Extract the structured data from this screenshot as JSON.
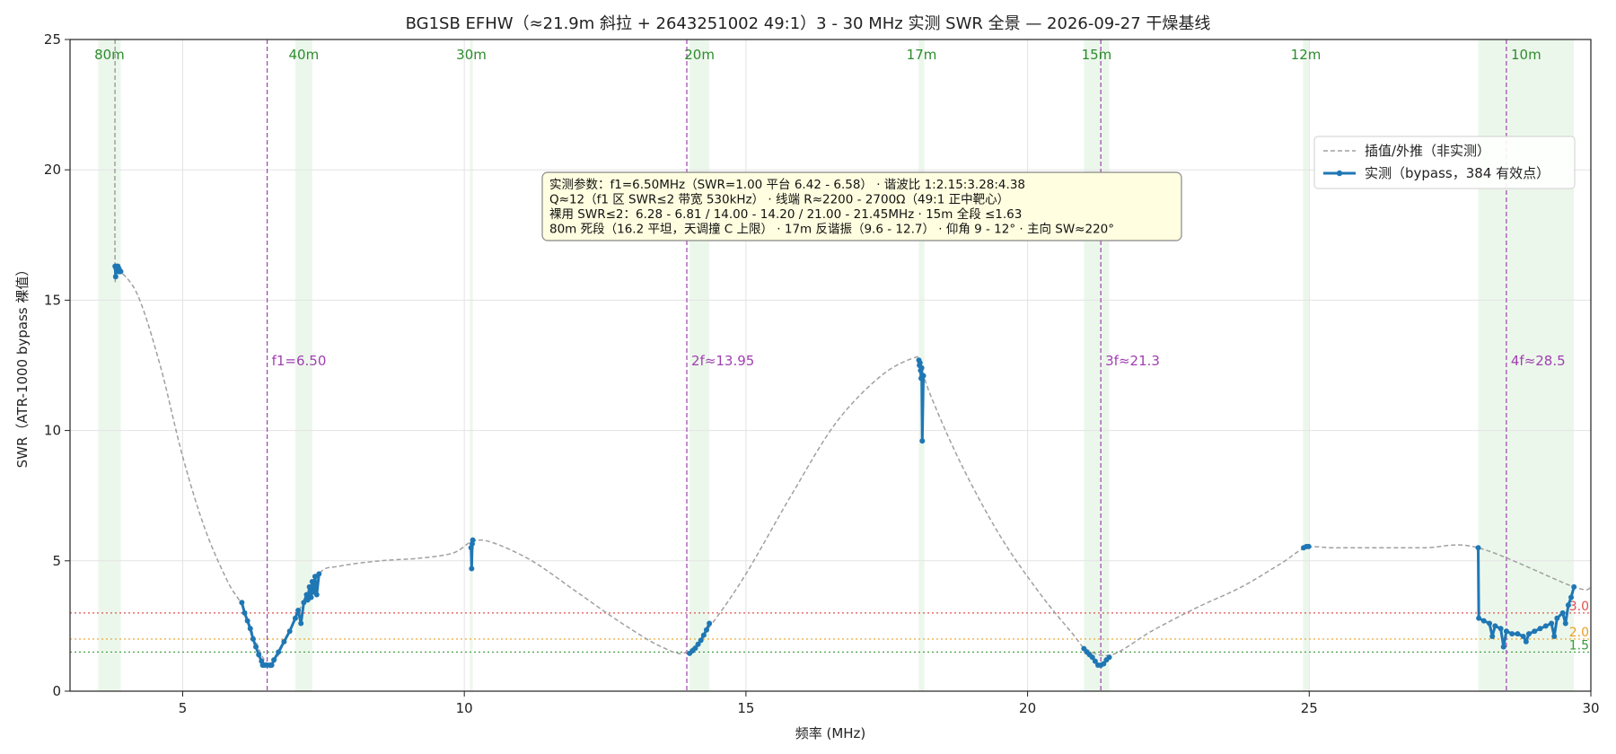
{
  "chart_data": {
    "type": "line",
    "title": "BG1SB EFHW（≈21.9m 斜拉 + 2643251002 49:1）3 - 30 MHz 实测 SWR 全景 — 2026-09-27 干燥基线",
    "xlabel": "频率 (MHz)",
    "ylabel": "SWR（ATR-1000 bypass 裸值）",
    "xlim": [
      3,
      30
    ],
    "ylim": [
      0,
      25
    ],
    "xticks": [
      5,
      10,
      15,
      20,
      25,
      30
    ],
    "yticks": [
      0,
      5,
      10,
      15,
      20,
      25
    ],
    "grid": true,
    "legend_position": "upper-right",
    "colors": {
      "measured": "#1f77b4",
      "interp": "#a0a0a0",
      "harmonic": "#a040b0",
      "band_fill": "#e6f4e6",
      "band_label": "#2e8b2e",
      "ref3": "#e05050",
      "ref2": "#e8a020",
      "ref15": "#3a9a3a"
    },
    "legend": [
      {
        "label": "插值/外推（非实测）",
        "style": "dashed"
      },
      {
        "label": "实测（bypass，384 有效点）",
        "style": "solid-marker"
      }
    ],
    "bands": [
      {
        "label": "80m",
        "start": 3.5,
        "end": 3.9
      },
      {
        "label": "40m",
        "start": 7.0,
        "end": 7.3
      },
      {
        "label": "30m",
        "start": 10.1,
        "end": 10.15
      },
      {
        "label": "20m",
        "start": 14.0,
        "end": 14.35
      },
      {
        "label": "17m",
        "start": 18.068,
        "end": 18.168
      },
      {
        "label": "15m",
        "start": 21.0,
        "end": 21.45
      },
      {
        "label": "12m",
        "start": 24.89,
        "end": 24.99
      },
      {
        "label": "10m",
        "start": 28.0,
        "end": 29.7
      }
    ],
    "harmonics": [
      {
        "label": "f1=6.50",
        "x": 6.5
      },
      {
        "label": "2f≈13.95",
        "x": 13.95
      },
      {
        "label": "3f≈21.3",
        "x": 21.3
      },
      {
        "label": "4f≈28.5",
        "x": 28.5
      }
    ],
    "ref_lines": [
      {
        "label": "3.0",
        "y": 3.0
      },
      {
        "label": "2.0",
        "y": 2.0
      },
      {
        "label": "1.5",
        "y": 1.5
      }
    ],
    "annotation": [
      "实测参数：f1=6.50MHz（SWR=1.00 平台 6.42 - 6.58） · 谐波比 1:2.15:3.28:4.38",
      "Q≈12（f1 区 SWR≤2 带宽 530kHz） · 线端 R≈2200 - 2700Ω（49:1 正中靶心）",
      "裸用 SWR≤2：6.28 - 6.81 / 14.00 - 14.20 / 21.00 - 21.45MHz · 15m 全段 ≤1.63",
      "80m 死段（16.2 平坦，天调撞 C 上限） · 17m 反谐振（9.6 - 12.7） · 仰角 9 - 12° · 主向 SW≈220°"
    ],
    "series": [
      {
        "name": "插值/外推（非实测）",
        "style": "dashed",
        "x": [
          3.8,
          3.8,
          3.85,
          4.2,
          4.6,
          5.0,
          5.4,
          5.8,
          6.05,
          6.3,
          6.45,
          6.6,
          7.0,
          7.42,
          7.8,
          8.5,
          9.2,
          9.8,
          10.15,
          10.5,
          11.2,
          12.0,
          12.8,
          13.5,
          13.95,
          14.4,
          15.0,
          15.8,
          16.6,
          17.4,
          18.0,
          18.1,
          18.25,
          18.8,
          19.5,
          20.2,
          20.8,
          21.05,
          21.5,
          22.2,
          23.0,
          23.8,
          24.5,
          24.95,
          25.5,
          27.0,
          28.0,
          29.7,
          30.0
        ],
        "y": [
          25.0,
          16.3,
          16.2,
          15.2,
          12.5,
          9.0,
          6.2,
          4.2,
          3.3,
          1.9,
          1.2,
          1.0,
          2.8,
          4.5,
          4.8,
          5.0,
          5.1,
          5.3,
          5.75,
          5.7,
          5.0,
          3.8,
          2.6,
          1.7,
          1.5,
          2.6,
          4.5,
          7.5,
          10.3,
          12.1,
          12.8,
          12.6,
          11.5,
          8.8,
          6.0,
          3.8,
          2.2,
          1.6,
          1.4,
          2.3,
          3.2,
          4.0,
          4.9,
          5.5,
          5.5,
          5.5,
          5.5,
          4.0,
          4.0
        ]
      },
      {
        "name": "实测（bypass，384 有效点）",
        "style": "solid-marker",
        "segments": [
          {
            "x": [
              3.8,
              3.81,
              3.82,
              3.83,
              3.84,
              3.85,
              3.86,
              3.87,
              3.88,
              3.9
            ],
            "y": [
              16.3,
              15.9,
              16.2,
              16.3,
              16.2,
              16.3,
              16.1,
              16.2,
              16.1,
              16.1
            ]
          },
          {
            "x": [
              6.05,
              6.1,
              6.15,
              6.2,
              6.25,
              6.3,
              6.35,
              6.4,
              6.42,
              6.45,
              6.5,
              6.55,
              6.58,
              6.62,
              6.7,
              6.8,
              6.9,
              7.0,
              7.05,
              7.1,
              7.15,
              7.2,
              7.22,
              7.25,
              7.28,
              7.3,
              7.32,
              7.35,
              7.38,
              7.42
            ],
            "y": [
              3.4,
              3.0,
              2.7,
              2.4,
              2.0,
              1.7,
              1.4,
              1.15,
              1.0,
              1.0,
              1.0,
              1.0,
              1.0,
              1.2,
              1.5,
              1.9,
              2.3,
              2.8,
              3.1,
              2.6,
              3.4,
              3.7,
              3.5,
              4.0,
              3.6,
              4.2,
              3.8,
              4.4,
              3.7,
              4.5
            ]
          },
          {
            "x": [
              10.12,
              10.13,
              10.14,
              10.15
            ],
            "y": [
              5.5,
              4.7,
              5.65,
              5.8
            ]
          },
          {
            "x": [
              14.0,
              14.05,
              14.1,
              14.15,
              14.2,
              14.25,
              14.3,
              14.35
            ],
            "y": [
              1.45,
              1.55,
              1.65,
              1.8,
              1.95,
              2.15,
              2.35,
              2.6
            ]
          },
          {
            "x": [
              18.07,
              18.08,
              18.09,
              18.1,
              18.11,
              18.12,
              18.13,
              18.15
            ],
            "y": [
              12.7,
              12.5,
              12.6,
              12.3,
              12.0,
              12.4,
              9.6,
              12.1
            ]
          },
          {
            "x": [
              21.0,
              21.05,
              21.1,
              21.15,
              21.2,
              21.25,
              21.3,
              21.35,
              21.4,
              21.45
            ],
            "y": [
              1.63,
              1.5,
              1.4,
              1.3,
              1.15,
              1.0,
              1.0,
              1.05,
              1.2,
              1.3
            ]
          },
          {
            "x": [
              24.9,
              24.95,
              24.99
            ],
            "y": [
              5.5,
              5.55,
              5.55
            ]
          },
          {
            "x": [
              28.0,
              28.01,
              28.1,
              28.2,
              28.25,
              28.3,
              28.4,
              28.45,
              28.5,
              28.6,
              28.7,
              28.8,
              28.85,
              28.9,
              29.0,
              29.1,
              29.2,
              29.3,
              29.35,
              29.4,
              29.5,
              29.55,
              29.6,
              29.65,
              29.7
            ],
            "y": [
              5.5,
              2.8,
              2.7,
              2.6,
              2.1,
              2.5,
              2.4,
              1.7,
              2.3,
              2.2,
              2.2,
              2.1,
              1.9,
              2.2,
              2.3,
              2.4,
              2.5,
              2.6,
              2.1,
              2.8,
              3.0,
              2.6,
              3.3,
              3.6,
              4.0
            ]
          }
        ]
      }
    ]
  }
}
